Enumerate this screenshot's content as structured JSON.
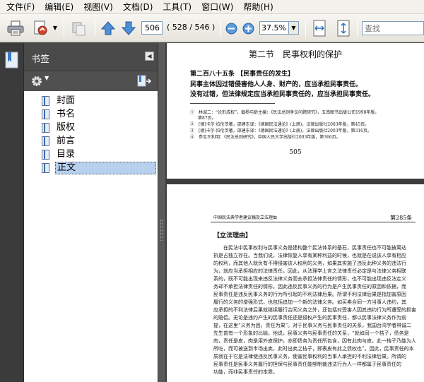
{
  "menu": [
    "文件(F)",
    "编辑(E)",
    "视图(V)",
    "文档(D)",
    "工具(T)",
    "窗口(W)",
    "帮助(H)"
  ],
  "toolbar": {
    "page_number": "506",
    "page_total": "( 528 / 546 )",
    "zoom": "37.5%",
    "search_placeholder": "查找"
  },
  "panel": {
    "title": "书签",
    "bookmarks": [
      "封面",
      "书名",
      "版权",
      "前言",
      "目录",
      "正文"
    ],
    "selected_index": 5
  },
  "page1": {
    "title": "第二节　民事权利的保护",
    "heading": "第二百八十五条 【民事责任的发生】",
    "bold1": "民事主体因过错侵害他人人身、财产的，应当承担民事责任。",
    "bold2": "没有过错，但法律规定应当承担民事责任的，应当承担民事责任。",
    "footnotes": [
      "①　林诚二：“论形成权”，载杨与龄主编：《民法总则争议问题研究》，五南图书出版公司1998年版，",
      "第87页。",
      "②　[德]卡尔·拉伦茨著，邵建东译：《德国民法通论》(上册)，法律出版社2003年版，第45页。",
      "③　[德]卡尔·拉伦茨著，邵建东译：《德国民法通论》(上册)，法律出版社2003年版，第316页。",
      "④　参见王利明：《民法总则研究》，中国人民大学出版社2003年版，第366页。"
    ],
    "page_number": "505"
  },
  "page2": {
    "header": "中国民法典学者建议稿及立法理由",
    "page_label": "第285条",
    "subheading": "【立法理由】",
    "lines": [
      "　　在民法中民事权利与民事义务是建构整个民法体系的基石，民事责任也不可能被离达",
      "执是占独立存在。当我们说，法律恢复人享有某种利益的时候，也就是在说该人享有相应",
      "的权利，而其他人就负有不得侵害该人权利的义务，如果其实施了违反此种义务的违法行",
      "为，就应当承担相应的法律责任。因此，从法理学上言之法律责任必定是与法律义务相联",
      "系的，既不可能出现来违反法律义务而去承担法律责任的情形，也不可能出现违反法定义",
      "务却不承担法律责任的情形。因此违反民事义务的行为是产生民事责任的原因和依据，而",
      "民事责任是违反民事义务的行为所引起的不利法律后果。所谓不利法律后果是指加害原因",
      "履行的义务的增强形式，也包括追加一个新的法律义务。如买卖合同一方当事人违约，其",
      "应承担的不利法律后果就继续履行合同义务之外，还包括对受害人因其违约行为所遭受的损害",
      "的赔偿。无论是违约产生的民事责任还是侵权产生的民事责任，都以民事法律义务作为前",
      "提，在这里“义务为因，责任为果”。对于民事义务与民事责任的关系，我国台湾学者林诚二",
      "先生曾有一个形象的比喻，他说，民事义务与民事责任的关系，“就如同一个桔子，债务是",
      "肉，责任是皮，肉是用外皮保护，亦即债务为责任所包含，因有此肉与皮，此一桔子乃能为人",
      "所吃，而可被送到市场出卖，此时出卖之桔子，即表皮有此之债权也”。因此，民事责任的本",
      "质就在于它是法律使违反民事义务，使害民事权利的当事人承担的不利法律后果。所谓的",
      "民事责任是民事义务履行的担保与民事责任能够制裁违法行为人一样都属于民事责任的",
      "功能，而非民事责任的本质。"
    ]
  }
}
